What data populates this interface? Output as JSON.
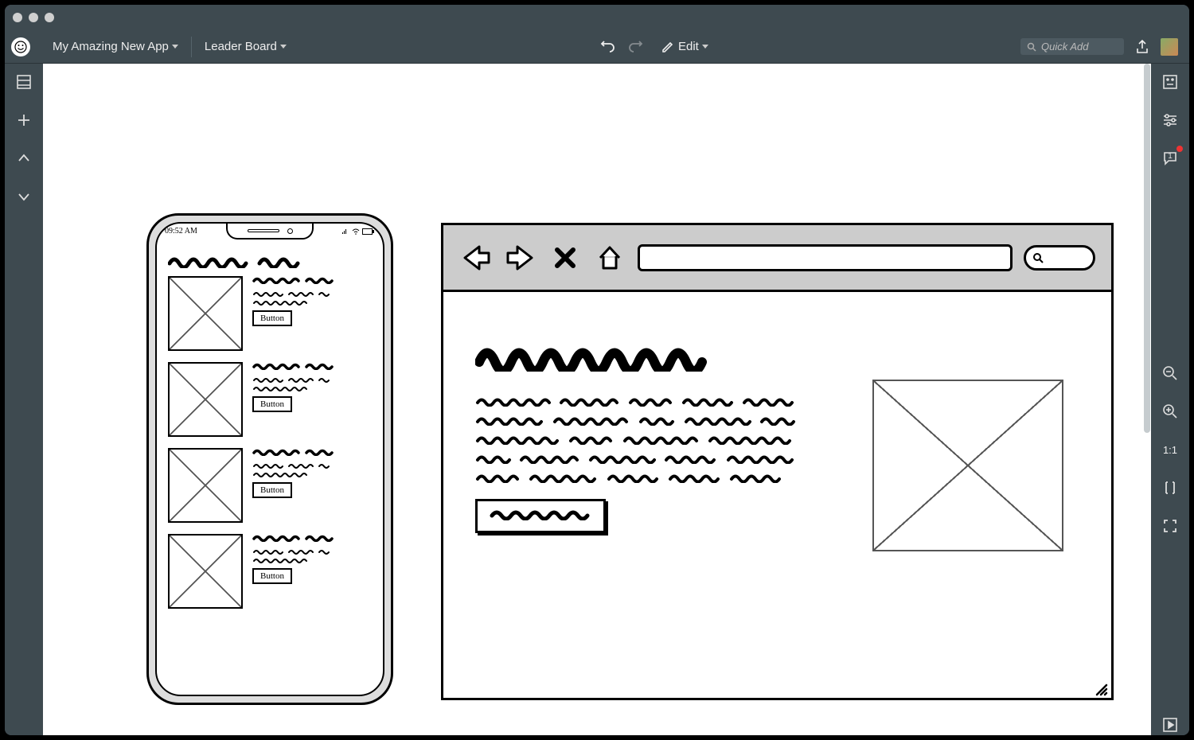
{
  "toolbar": {
    "project_name": "My Amazing New App",
    "page_name": "Leader Board",
    "edit_label": "Edit",
    "quick_add_placeholder": "Quick Add"
  },
  "right_rail": {
    "comment_count": "1",
    "zoom_ratio": "1:1"
  },
  "phone": {
    "time": "09:52 AM",
    "items": [
      {
        "button_label": "Button"
      },
      {
        "button_label": "Button"
      },
      {
        "button_label": "Button"
      },
      {
        "button_label": "Button"
      }
    ]
  }
}
